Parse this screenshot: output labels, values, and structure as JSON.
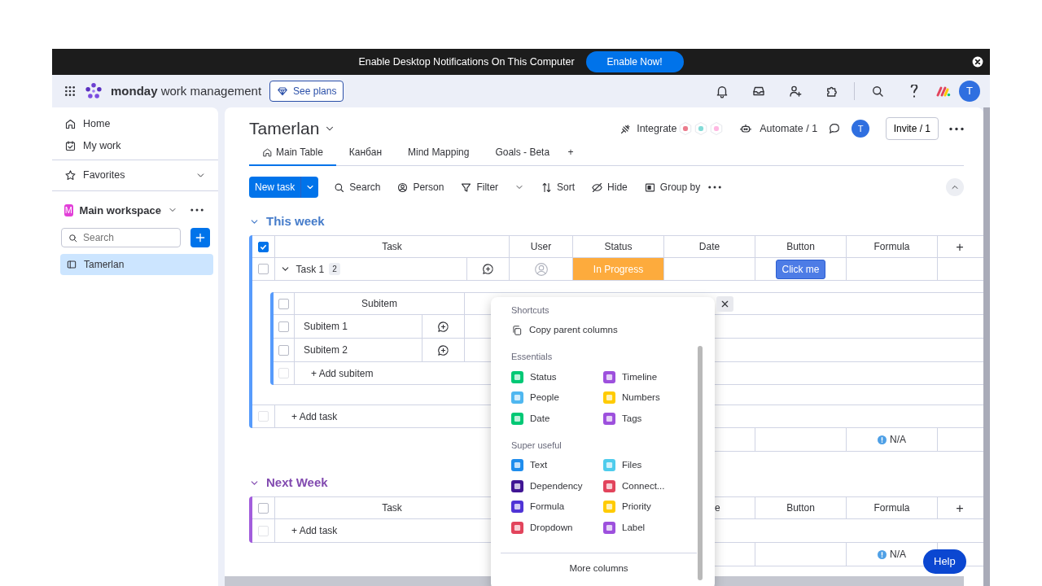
{
  "notification_bar": {
    "message": "Enable Desktop Notifications On This Computer",
    "button": "Enable Now!"
  },
  "topbar": {
    "brand_bold": "monday",
    "brand_rest": "work management",
    "plans_button": "See plans",
    "avatar": "T"
  },
  "sidebar": {
    "nav": [
      {
        "label": "Home",
        "kind": "home"
      },
      {
        "label": "My work",
        "kind": "calendar"
      }
    ],
    "favorites": {
      "label": "Favorites",
      "expanded": false
    },
    "workspace": {
      "badge": "M",
      "name": "Main workspace"
    },
    "search": {
      "placeholder": "Search"
    },
    "boards": [
      {
        "label": "Tamerlan",
        "selected": true
      }
    ]
  },
  "board": {
    "title": "Tamerlan",
    "integrate": "Integrate",
    "automate": "Automate / 1",
    "avatar": "T",
    "invite": "Invite / 1",
    "views": [
      {
        "label": "Main Table",
        "selected": true,
        "kind": "home"
      },
      {
        "label": "Канбан",
        "selected": false
      },
      {
        "label": "Mind Mapping",
        "selected": false
      },
      {
        "label": "Goals - Beta",
        "selected": false
      }
    ],
    "add_view": "+",
    "new_task": "New task",
    "toolbar": [
      {
        "label": "Search",
        "kind": "search",
        "dropdown": false
      },
      {
        "label": "Person",
        "kind": "user-circle",
        "dropdown": false
      },
      {
        "label": "Filter",
        "kind": "filter",
        "dropdown": true
      },
      {
        "label": "Sort",
        "kind": "sort",
        "dropdown": false
      },
      {
        "label": "Hide",
        "kind": "eye-off",
        "dropdown": false
      },
      {
        "label": "Group by",
        "kind": "group",
        "dropdown": false
      }
    ]
  },
  "groups": [
    {
      "title": "This week",
      "color": "#579bfc",
      "checked": true,
      "add_row_checked": false,
      "columns": [
        {
          "kind": "task",
          "label": "Task"
        },
        {
          "kind": "user",
          "label": "User"
        },
        {
          "kind": "status",
          "label": "Status"
        },
        {
          "kind": "date",
          "label": "Date"
        },
        {
          "kind": "button",
          "label": "Button"
        },
        {
          "kind": "formula",
          "label": "Formula"
        },
        {
          "kind": "add",
          "label": "+"
        }
      ],
      "rows": [
        {
          "name": "Task 1",
          "count": "2",
          "checked": false,
          "expanded": true,
          "status": {
            "label": "In Progress",
            "color": "#fdab3d"
          },
          "button": "Click me",
          "subitems": {
            "header": "Subitem",
            "checked": false,
            "add_row_checked": false,
            "rows": [
              {
                "name": "Subitem 1",
                "checked": false
              },
              {
                "name": "Subitem 2",
                "checked": false
              }
            ],
            "add": "+ Add subitem"
          }
        }
      ],
      "add_task": "+ Add task",
      "summary": "N/A"
    },
    {
      "title": "Next Week",
      "color": "#a25ddc",
      "checked": false,
      "add_row_checked": false,
      "columns": [
        {
          "kind": "task",
          "label": "Task"
        },
        {
          "kind": "covered"
        },
        {
          "kind": "tail",
          "label": "e"
        },
        {
          "kind": "button",
          "label": "Button"
        },
        {
          "kind": "formula",
          "label": "Formula"
        },
        {
          "kind": "add",
          "label": "+"
        }
      ],
      "add_task": "+ Add task",
      "summary": "N/A"
    }
  ],
  "column_picker": {
    "sections": [
      {
        "title": "Shortcuts",
        "kind": "list",
        "items": [
          {
            "label": "Copy parent columns"
          }
        ]
      },
      {
        "title": "Essentials",
        "kind": "grid",
        "items": [
          {
            "label": "Status",
            "color": "#00c875"
          },
          {
            "label": "Timeline",
            "color": "#9d50dd"
          },
          {
            "label": "People",
            "color": "#4fb7f0"
          },
          {
            "label": "Numbers",
            "color": "#ffcb00"
          },
          {
            "label": "Date",
            "color": "#00c875"
          },
          {
            "label": "Tags",
            "color": "#9d50dd"
          }
        ]
      },
      {
        "title": "Super useful",
        "kind": "grid",
        "items": [
          {
            "label": "Text",
            "color": "#1f8ded"
          },
          {
            "label": "Files",
            "color": "#4eccec"
          },
          {
            "label": "Dependency",
            "color": "#401694"
          },
          {
            "label": "Connect...",
            "color": "#e2445c"
          },
          {
            "label": "Formula",
            "color": "#5034d6"
          },
          {
            "label": "Priority",
            "color": "#ffcb00"
          },
          {
            "label": "Dropdown",
            "color": "#e2445c"
          },
          {
            "label": "Label",
            "color": "#9d50dd"
          }
        ]
      }
    ],
    "more": "More columns"
  },
  "help": "Help"
}
